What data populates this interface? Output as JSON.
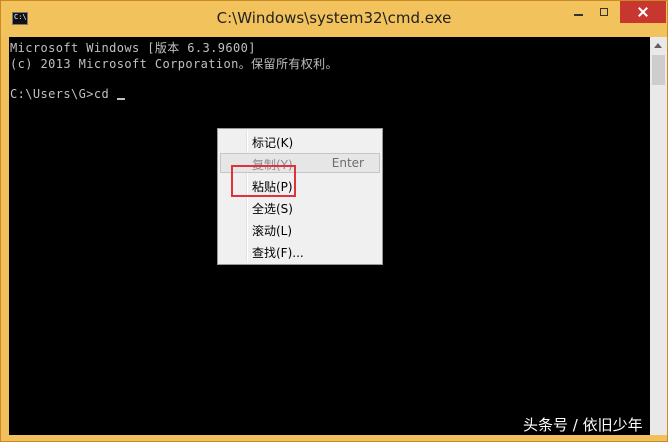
{
  "window": {
    "title": "C:\\Windows\\system32\\cmd.exe",
    "icon_label": "C:\\",
    "icon": "cmd-icon"
  },
  "console": {
    "lines": [
      "Microsoft Windows [版本 6.3.9600]",
      "(c) 2013 Microsoft Corporation。保留所有权利。",
      "",
      "C:\\Users\\G>cd"
    ]
  },
  "context_menu": {
    "items": [
      {
        "label": "标记(K)",
        "shortcut": "",
        "enabled": true
      },
      {
        "label": "复制(Y)",
        "shortcut": "Enter",
        "enabled": false
      },
      {
        "label": "粘贴(P)",
        "shortcut": "",
        "enabled": true
      },
      {
        "label": "全选(S)",
        "shortcut": "",
        "enabled": true
      },
      {
        "label": "滚动(L)",
        "shortcut": "",
        "enabled": true
      },
      {
        "label": "查找(F)...",
        "shortcut": "",
        "enabled": true
      }
    ]
  },
  "annotation": {
    "color": "#e0323a",
    "target": "粘贴(P)"
  },
  "watermark": {
    "text": "头条号 / 依旧少年"
  },
  "colors": {
    "titlebar": "#f2c25c",
    "console_bg": "#000000",
    "console_text": "#c0c0c0",
    "close": "#c7372f"
  }
}
